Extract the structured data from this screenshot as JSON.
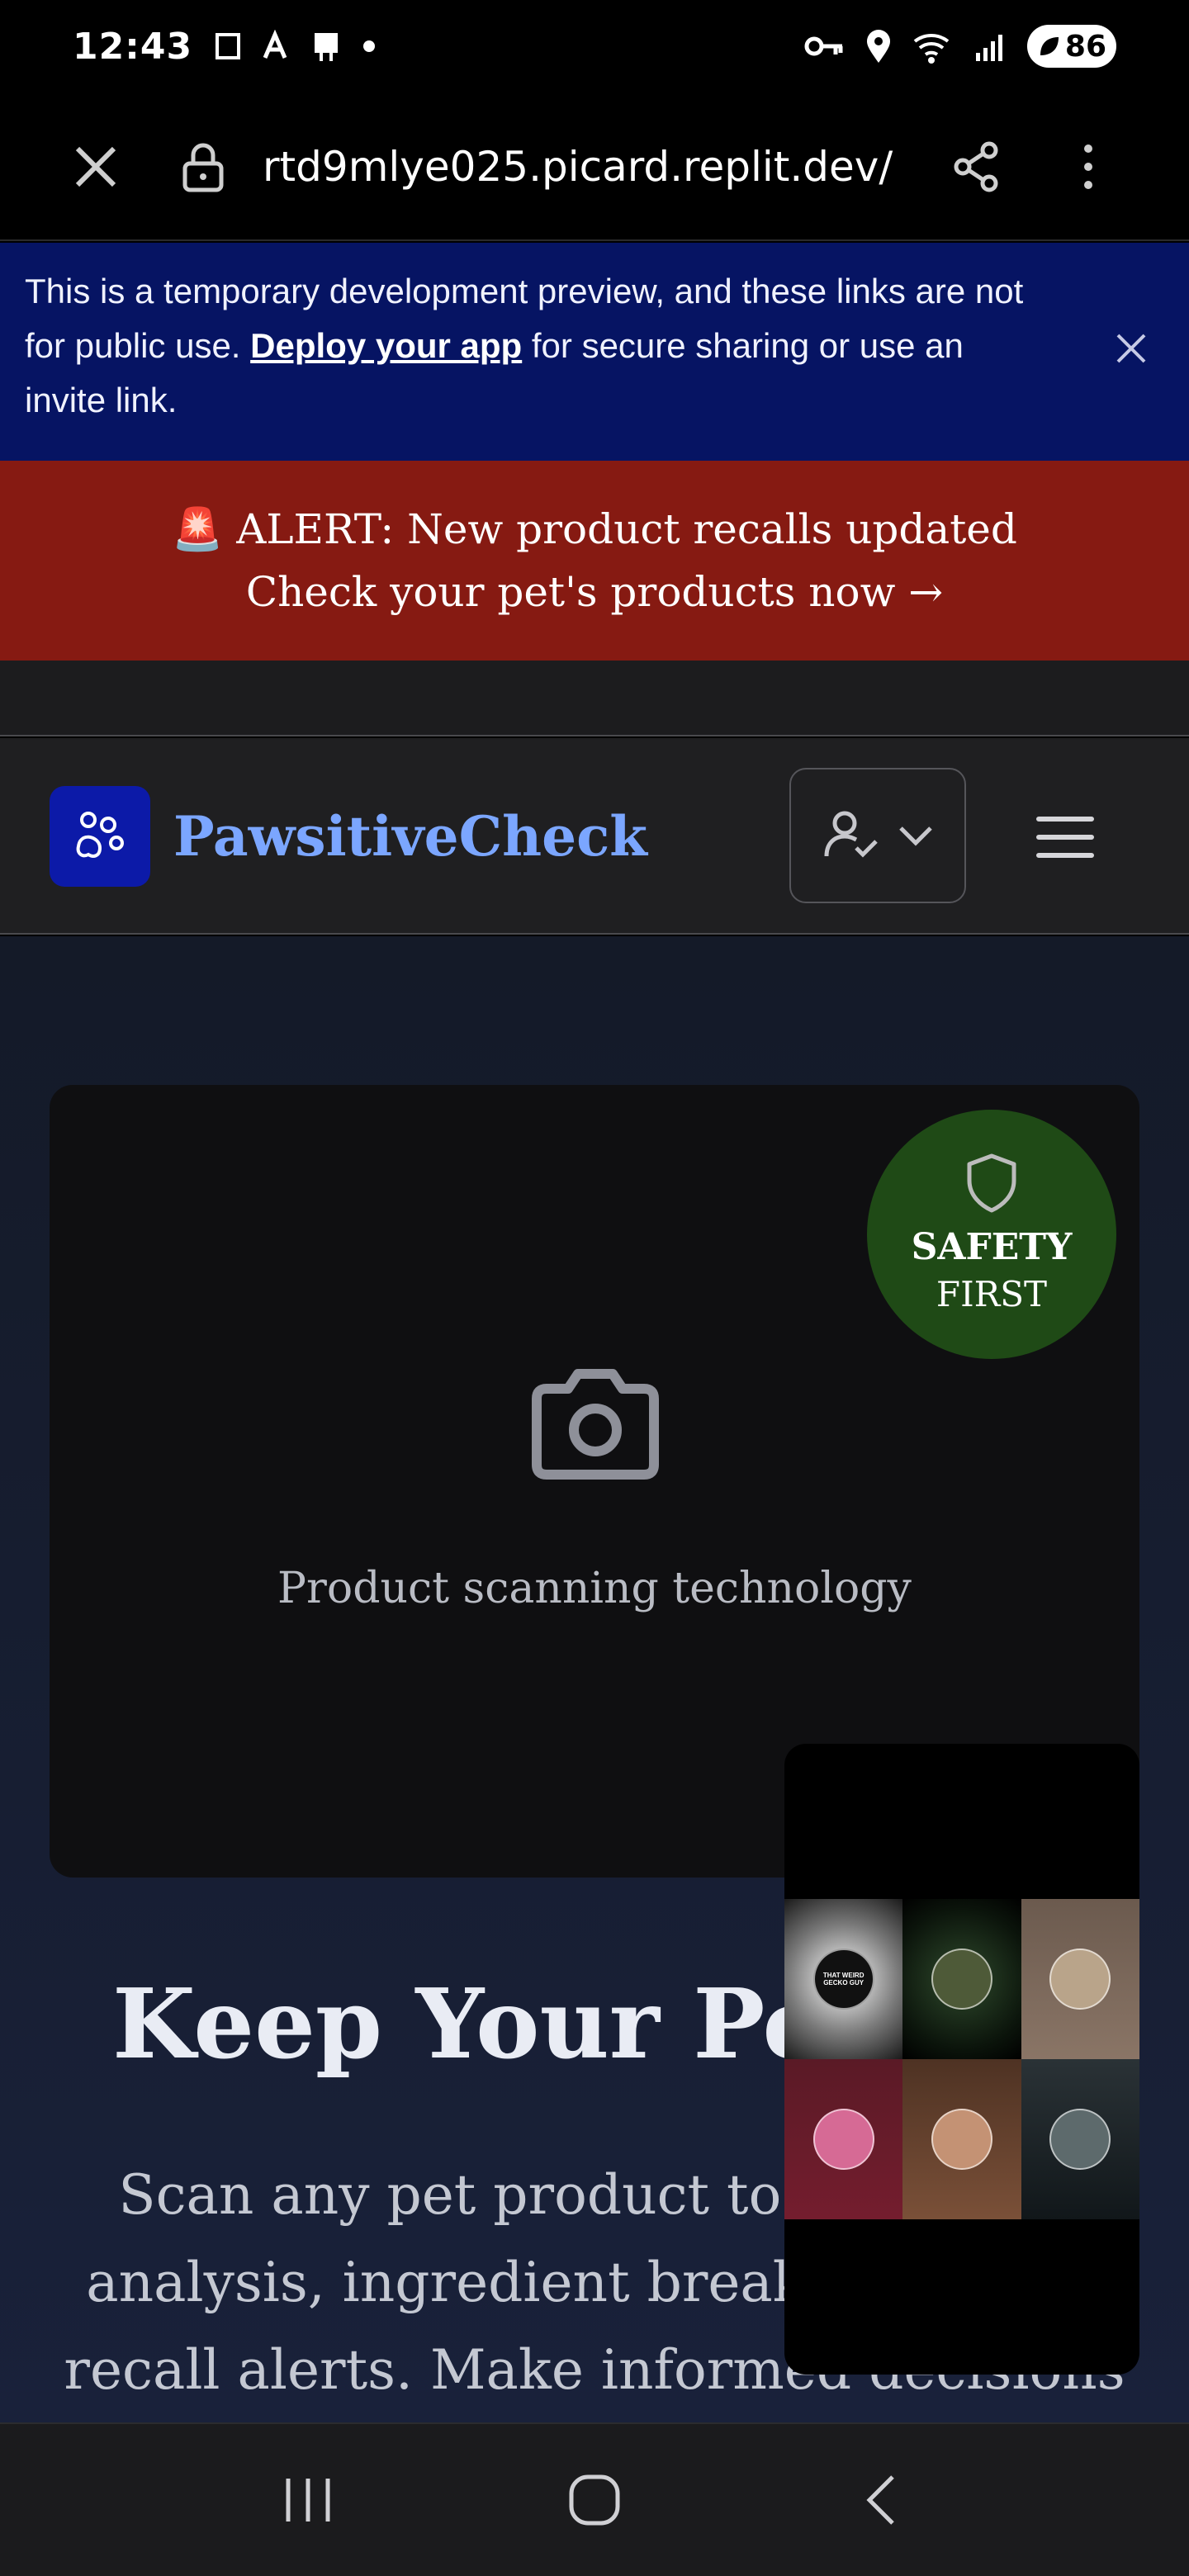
{
  "status_bar": {
    "time": "12:43",
    "battery": "86"
  },
  "browser": {
    "url": "rtd9mlye025.picard.replit.dev/"
  },
  "dev_banner": {
    "text_before": "This is a temporary development preview, and these links are not for public use. ",
    "link": "Deploy your app",
    "text_after": " for secure sharing or use an invite link."
  },
  "alert": {
    "line1": "🚨 ALERT: New product recalls updated",
    "line2": "Check your pet's products now →"
  },
  "header": {
    "brand": "PawsitiveCheck"
  },
  "main": {
    "badge_line1": "SAFETY",
    "badge_line2": "FIRST",
    "scan_caption": "Product scanning technology",
    "hero_title": "Keep Your Pets",
    "hero_desc": "Scan any pet product to get safety analysis, ingredient breakdowns and recall alerts. Make informed decisions for your pets' health."
  },
  "overlay": {
    "avatar_1_text": "THAT WEIRD GECKO GUY"
  },
  "colors": {
    "dev_banner_bg": "#061463",
    "alert_bg": "#861a12",
    "brand_text": "#7ba6ff",
    "logo_bg": "#0c1aa8",
    "badge_bg": "#1f4a16"
  },
  "icons": [
    "close-icon",
    "lock-icon",
    "share-icon",
    "more-vert-icon",
    "paw-icon",
    "user-check-icon",
    "chevron-down-icon",
    "hamburger-icon",
    "shield-icon",
    "camera-icon",
    "recents-icon",
    "home-icon",
    "back-icon"
  ]
}
